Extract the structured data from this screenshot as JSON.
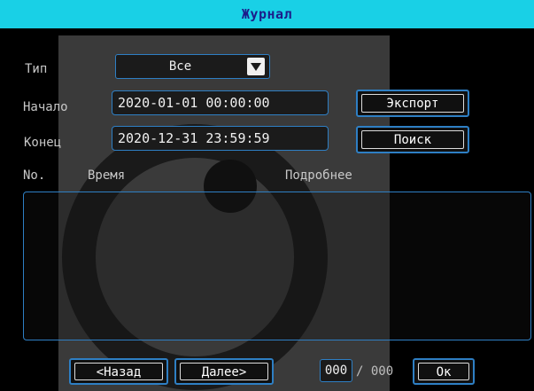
{
  "window": {
    "title": "Журнал"
  },
  "filters": {
    "type_label": "Тип",
    "type_value": "Все",
    "start_label": "Начало",
    "start_value": "2020-01-01 00:00:00",
    "end_label": "Конец",
    "end_value": "2020-12-31 23:59:59"
  },
  "actions": {
    "export_label": "Экспорт",
    "search_label": "Поиск"
  },
  "table": {
    "columns": [
      "No.",
      "Время",
      "Подробнее"
    ],
    "rows": []
  },
  "pagination": {
    "prev_label": "<Назад",
    "next_label": "Далее>",
    "current_page": "000",
    "separator_total": "/ 000",
    "ok_label": "Ок"
  },
  "colors": {
    "title_bar": "#19d0e6",
    "title_text": "#1c1c8a",
    "border": "#2e7fc4",
    "background": "#000000"
  }
}
